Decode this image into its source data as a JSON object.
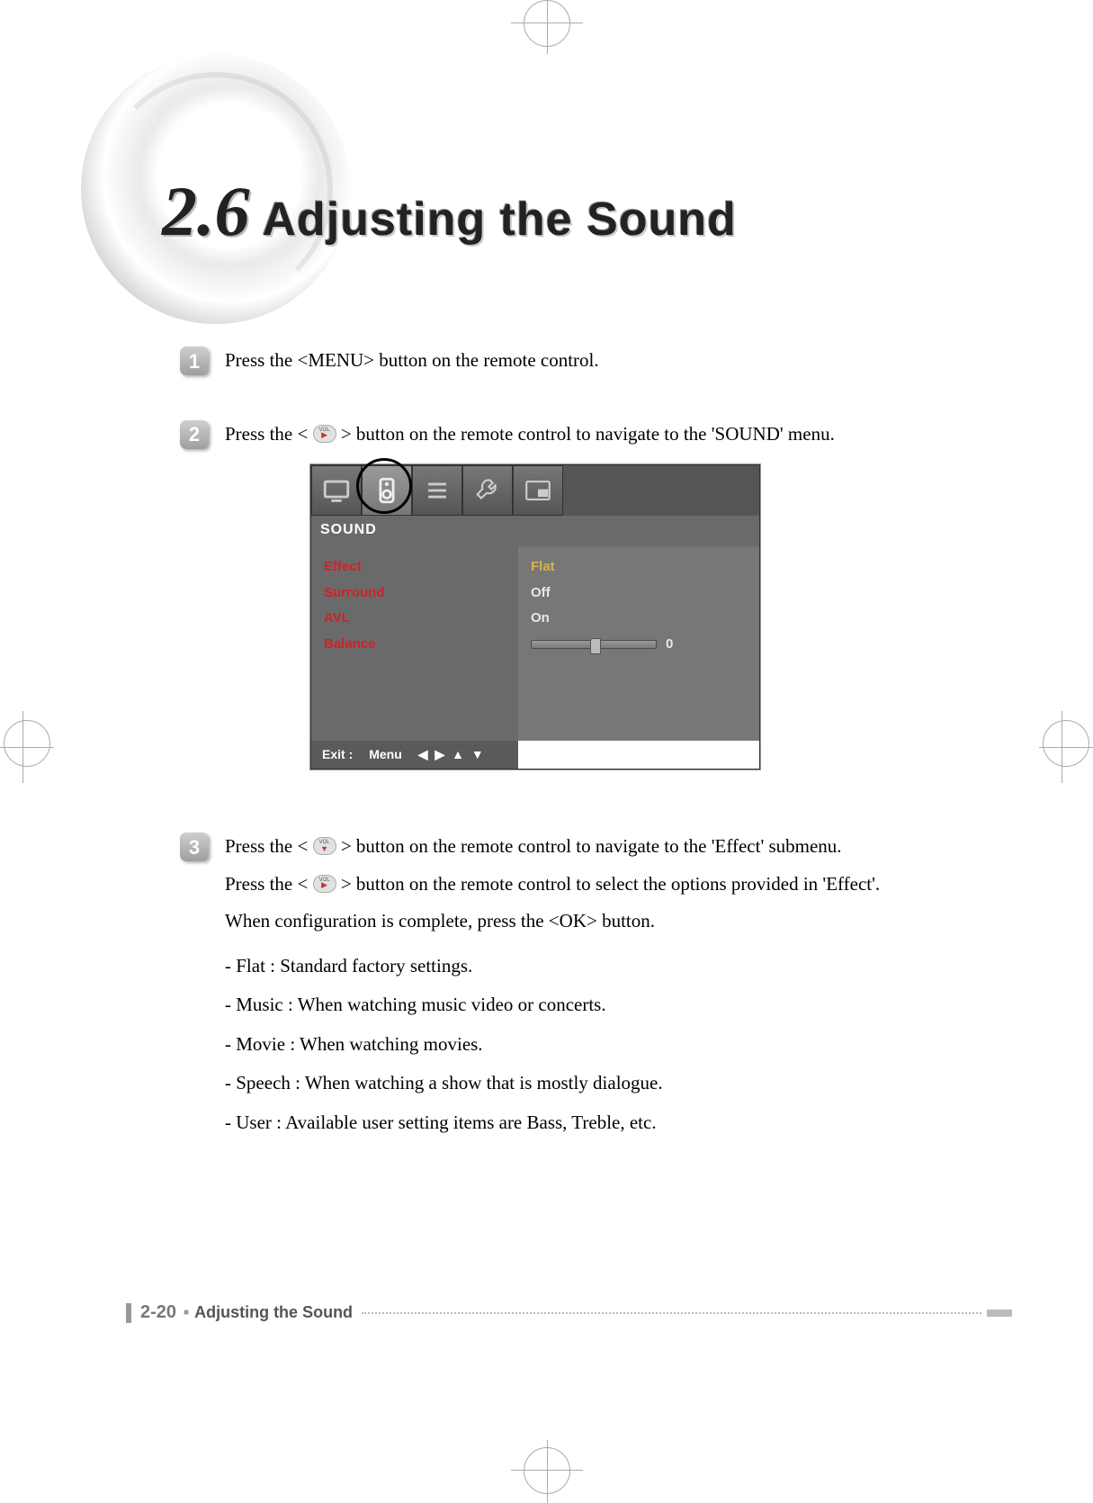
{
  "heading": {
    "number": "2.6",
    "title": "Adjusting the Sound"
  },
  "steps": {
    "1": {
      "badge": "1",
      "text": "Press the <MENU> button on the remote control."
    },
    "2": {
      "badge": "2",
      "text_a": "Press the <",
      "text_b": "> button on the remote control to navigate to the 'SOUND' menu."
    },
    "3": {
      "badge": "3",
      "l1a": "Press the <",
      "l1b": "> button on the remote control to navigate to the 'Effect' submenu.",
      "l2a": "Press the <",
      "l2b": "> button on the remote control to select the options provided in 'Effect'.",
      "l3": "When configuration is complete, press the <OK> button.",
      "b1": "- Flat : Standard factory settings.",
      "b2": "- Music : When watching music video or concerts.",
      "b3": "- Movie : When watching movies.",
      "b4": "- Speech : When watching a show that is mostly dialogue.",
      "b5": "- User : Available user setting items are Bass, Treble, etc."
    }
  },
  "osd": {
    "header": "SOUND",
    "rows": {
      "effect": {
        "label": "Effect",
        "value": "Flat"
      },
      "surround": {
        "label": "Surround",
        "value": "Off"
      },
      "avl": {
        "label": "AVL",
        "value": "On"
      },
      "balance": {
        "label": "Balance",
        "value": "0"
      }
    },
    "footer": {
      "exit": "Exit :",
      "menu": "Menu",
      "arrows": "◀ ▶ ▲ ▼"
    }
  },
  "footer": {
    "page": "2-20",
    "square": "■",
    "title": "Adjusting the Sound"
  }
}
